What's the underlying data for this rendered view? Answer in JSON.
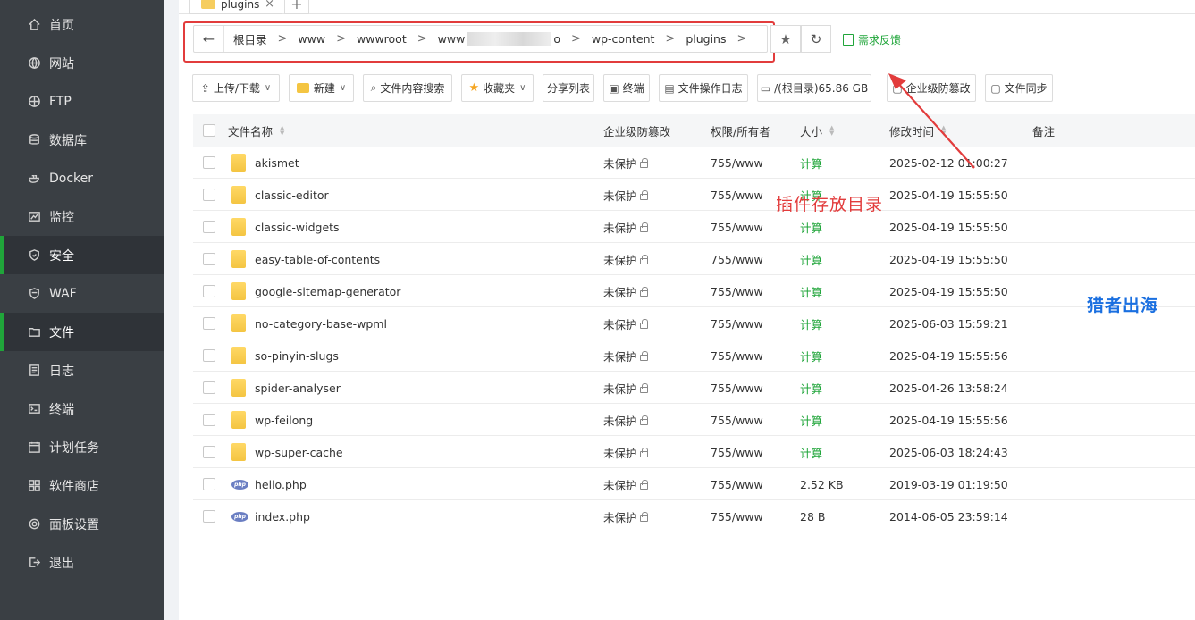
{
  "sidebar": {
    "items": [
      {
        "label": "首页",
        "icon": "home-icon"
      },
      {
        "label": "网站",
        "icon": "globe-icon"
      },
      {
        "label": "FTP",
        "icon": "ftp-icon"
      },
      {
        "label": "数据库",
        "icon": "database-icon"
      },
      {
        "label": "Docker",
        "icon": "docker-icon"
      },
      {
        "label": "监控",
        "icon": "monitor-icon"
      },
      {
        "label": "安全",
        "icon": "shield-icon"
      },
      {
        "label": "WAF",
        "icon": "waf-icon"
      },
      {
        "label": "文件",
        "icon": "folder-icon"
      },
      {
        "label": "日志",
        "icon": "log-icon"
      },
      {
        "label": "终端",
        "icon": "terminal-icon"
      },
      {
        "label": "计划任务",
        "icon": "task-icon"
      },
      {
        "label": "软件商店",
        "icon": "store-icon"
      },
      {
        "label": "面板设置",
        "icon": "settings-icon"
      },
      {
        "label": "退出",
        "icon": "logout-icon"
      }
    ],
    "active": "文件"
  },
  "tabs": {
    "current": "plugins",
    "close": "×",
    "add": "+"
  },
  "path": {
    "back": "←",
    "crumbs": [
      "根目录",
      "www",
      "wwwroot",
      "www",
      "o",
      "wp-content",
      "plugins"
    ],
    "sep": ">",
    "star": "★",
    "refresh": "↻",
    "feedback": "需求反馈"
  },
  "toolbar": {
    "upload": "上传/下载",
    "new": "新建",
    "search": "文件内容搜索",
    "favorites": "收藏夹",
    "share": "分享列表",
    "terminal": "终端",
    "oplog": "文件操作日志",
    "disk": "/(根目录)65.86 GB",
    "tamper": "企业级防篡改",
    "sync": "文件同步"
  },
  "table": {
    "headers": {
      "name": "文件名称",
      "tamper": "企业级防篡改",
      "perm": "权限/所有者",
      "size": "大小",
      "mtime": "修改时间",
      "note": "备注"
    },
    "rows": [
      {
        "name": "akismet",
        "type": "folder",
        "tamper": "未保护",
        "perm": "755/www",
        "size": "计算",
        "mtime": "2025-02-12 01:00:27"
      },
      {
        "name": "classic-editor",
        "type": "folder",
        "tamper": "未保护",
        "perm": "755/www",
        "size": "计算",
        "mtime": "2025-04-19 15:55:50"
      },
      {
        "name": "classic-widgets",
        "type": "folder",
        "tamper": "未保护",
        "perm": "755/www",
        "size": "计算",
        "mtime": "2025-04-19 15:55:50"
      },
      {
        "name": "easy-table-of-contents",
        "type": "folder",
        "tamper": "未保护",
        "perm": "755/www",
        "size": "计算",
        "mtime": "2025-04-19 15:55:50"
      },
      {
        "name": "google-sitemap-generator",
        "type": "folder",
        "tamper": "未保护",
        "perm": "755/www",
        "size": "计算",
        "mtime": "2025-04-19 15:55:50"
      },
      {
        "name": "no-category-base-wpml",
        "type": "folder",
        "tamper": "未保护",
        "perm": "755/www",
        "size": "计算",
        "mtime": "2025-06-03 15:59:21"
      },
      {
        "name": "so-pinyin-slugs",
        "type": "folder",
        "tamper": "未保护",
        "perm": "755/www",
        "size": "计算",
        "mtime": "2025-04-19 15:55:56"
      },
      {
        "name": "spider-analyser",
        "type": "folder",
        "tamper": "未保护",
        "perm": "755/www",
        "size": "计算",
        "mtime": "2025-04-26 13:58:24"
      },
      {
        "name": "wp-feilong",
        "type": "folder",
        "tamper": "未保护",
        "perm": "755/www",
        "size": "计算",
        "mtime": "2025-04-19 15:55:56"
      },
      {
        "name": "wp-super-cache",
        "type": "folder",
        "tamper": "未保护",
        "perm": "755/www",
        "size": "计算",
        "mtime": "2025-06-03 18:24:43"
      },
      {
        "name": "hello.php",
        "type": "php",
        "tamper": "未保护",
        "perm": "755/www",
        "size": "2.52 KB",
        "mtime": "2019-03-19 01:19:50"
      },
      {
        "name": "index.php",
        "type": "php",
        "tamper": "未保护",
        "perm": "755/www",
        "size": "28 B",
        "mtime": "2014-06-05 23:59:14"
      }
    ]
  },
  "annotation": {
    "label": "插件存放目录",
    "color": "#e23c3c"
  },
  "watermark": "猎者出海",
  "colors": {
    "accent": "#20a53a",
    "sidebar": "#3a3f44",
    "highlight": "#e23c3c"
  }
}
